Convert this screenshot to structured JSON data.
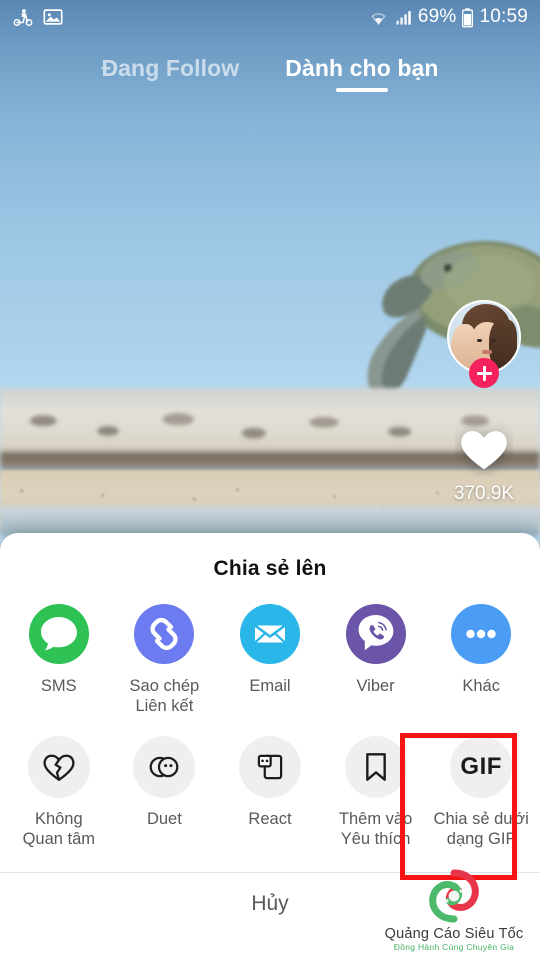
{
  "status_bar": {
    "left_icons": [
      {
        "name": "scooter-icon",
        "glyph": "scooter"
      },
      {
        "name": "gallery-icon",
        "glyph": "image"
      }
    ],
    "wifi_icon": "wifi-icon",
    "signal_icon": "signal-bars-icon",
    "battery_percent": "69%",
    "battery_icon": "battery-icon",
    "time": "10:59"
  },
  "tabs": [
    {
      "label": "Đang Follow",
      "active": false
    },
    {
      "label": "Dành cho bạn",
      "active": true
    }
  ],
  "video": {
    "author_avatar": "avatar",
    "follow_button": "follow-plus-button",
    "like_icon": "heart-icon",
    "like_count": "370.9K"
  },
  "share_sheet": {
    "title": "Chia sẻ lên",
    "apps": [
      {
        "label": "SMS",
        "icon": "sms-icon",
        "color": "#2ec154"
      },
      {
        "label": "Sao chép\nLiên kết",
        "icon": "link-icon",
        "color": "#6c7cf0"
      },
      {
        "label": "Email",
        "icon": "email-icon",
        "color": "#2ab6e8"
      },
      {
        "label": "Viber",
        "icon": "viber-icon",
        "color": "#6b55a8"
      },
      {
        "label": "Khác",
        "icon": "more-dots-icon",
        "color": "#4a9cf5"
      }
    ],
    "actions": [
      {
        "label": "Không\nQuan tâm",
        "icon": "broken-heart-icon",
        "highlighted": false
      },
      {
        "label": "Duet",
        "icon": "duet-icon",
        "highlighted": false
      },
      {
        "label": "React",
        "icon": "react-icon",
        "highlighted": false
      },
      {
        "label": "Thêm vào\nYêu thích",
        "icon": "bookmark-icon",
        "highlighted": false
      },
      {
        "label": "Chia sẻ dưới\ndạng GIF",
        "icon": "gif-icon",
        "icon_text": "GIF",
        "highlighted": true
      }
    ],
    "highlight_color": "#f51414",
    "cancel_label": "Hủy"
  },
  "watermark": {
    "name": "Quảng Cáo Siêu Tốc",
    "tagline": "Đồng Hành Cùng Chuyên Gia"
  }
}
